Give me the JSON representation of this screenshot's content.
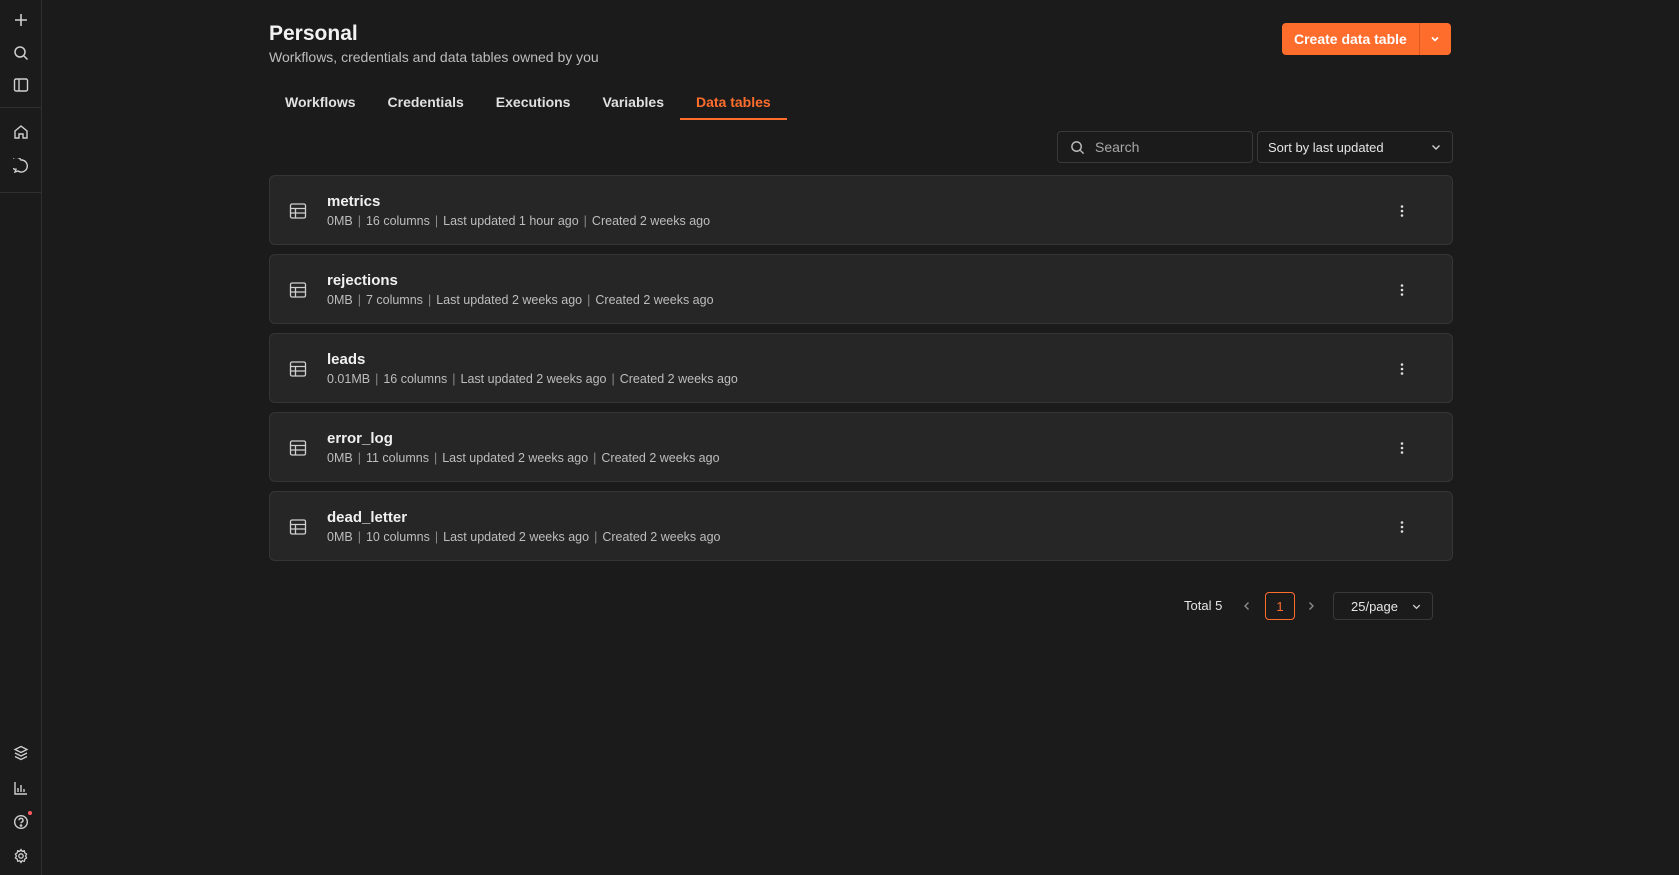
{
  "sidebar": {
    "top": [
      {
        "icon": "plus-icon"
      },
      {
        "icon": "search-icon"
      },
      {
        "icon": "sidebar-toggle-icon"
      }
    ],
    "middle": [
      {
        "icon": "home-icon"
      },
      {
        "icon": "chat-icon"
      }
    ],
    "bottom": [
      {
        "icon": "templates-icon"
      },
      {
        "icon": "insights-icon"
      },
      {
        "icon": "help-icon"
      },
      {
        "icon": "settings-icon"
      }
    ]
  },
  "header": {
    "title": "Personal",
    "subtitle": "Workflows, credentials and data tables owned by you",
    "create_label": "Create data table"
  },
  "tabs": [
    {
      "label": "Workflows",
      "active": false
    },
    {
      "label": "Credentials",
      "active": false
    },
    {
      "label": "Executions",
      "active": false
    },
    {
      "label": "Variables",
      "active": false
    },
    {
      "label": "Data tables",
      "active": true
    }
  ],
  "toolbar": {
    "search_placeholder": "Search",
    "search_value": "",
    "sort_label": "Sort by last updated"
  },
  "tables": [
    {
      "name": "metrics",
      "size": "0MB",
      "columns": "16 columns",
      "updated": "Last updated 1 hour ago",
      "created": "Created 2 weeks ago"
    },
    {
      "name": "rejections",
      "size": "0MB",
      "columns": "7 columns",
      "updated": "Last updated 2 weeks ago",
      "created": "Created 2 weeks ago"
    },
    {
      "name": "leads",
      "size": "0.01MB",
      "columns": "16 columns",
      "updated": "Last updated 2 weeks ago",
      "created": "Created 2 weeks ago"
    },
    {
      "name": "error_log",
      "size": "0MB",
      "columns": "11 columns",
      "updated": "Last updated 2 weeks ago",
      "created": "Created 2 weeks ago"
    },
    {
      "name": "dead_letter",
      "size": "0MB",
      "columns": "10 columns",
      "updated": "Last updated 2 weeks ago",
      "created": "Created 2 weeks ago"
    }
  ],
  "pagination": {
    "total_label": "Total 5",
    "current_page": "1",
    "per_page": "25/page"
  },
  "colors": {
    "accent": "#ff6d2d",
    "background": "#1b1b1b",
    "card": "#262626"
  }
}
